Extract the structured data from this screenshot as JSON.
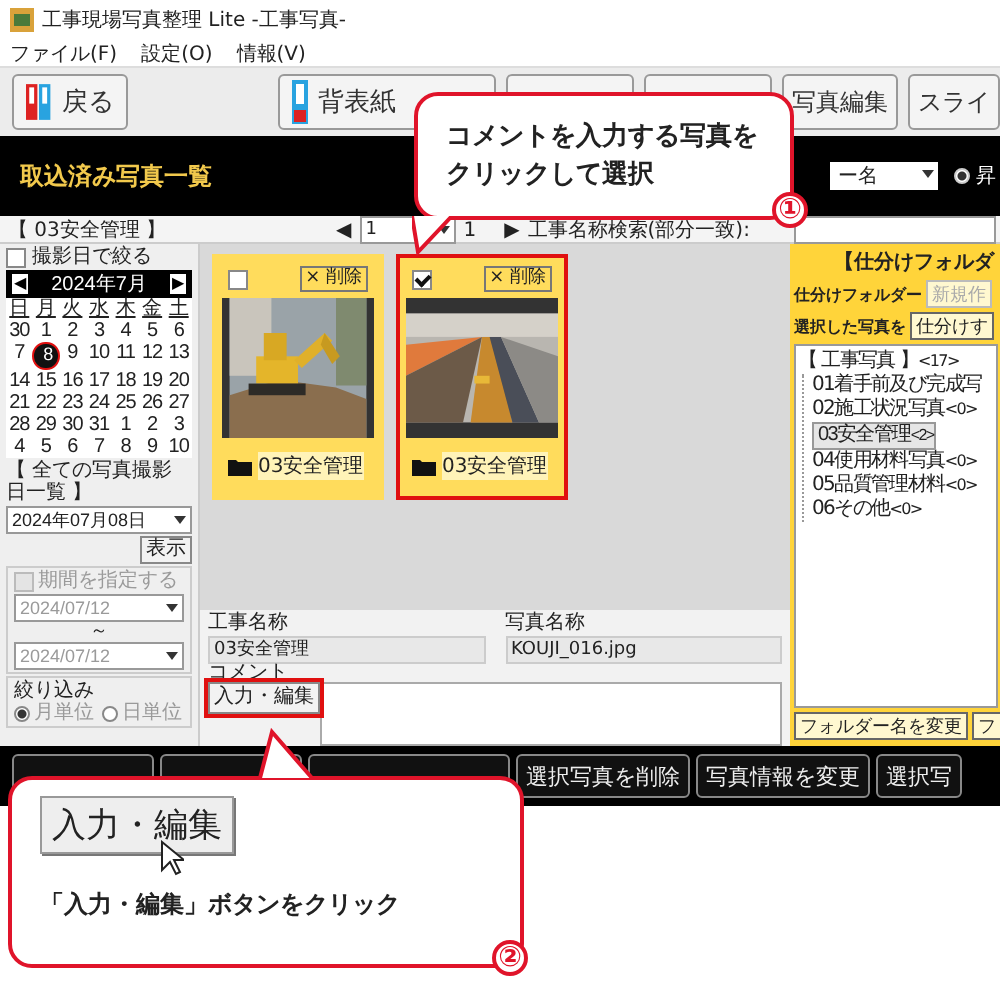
{
  "window": {
    "title": "工事現場写真整理 Lite -工事写真-"
  },
  "menu": [
    "ファイル(F)",
    "設定(O)",
    "情報(V)"
  ],
  "toolbar": [
    {
      "kind": "back",
      "label": "戻る"
    },
    {
      "kind": "spine",
      "label": "背表紙"
    },
    {
      "kind": "covered"
    },
    {
      "kind": "covered"
    },
    {
      "kind": "plain",
      "label": "写真編集"
    },
    {
      "kind": "plain",
      "label": "スライ"
    }
  ],
  "header": {
    "title": "取込済み写真一覧",
    "sort_select": "ー名",
    "sort_radio": {
      "label": "昇",
      "selected": true
    }
  },
  "folder_label": "【 03安全管理 】",
  "date_filter": {
    "label": "撮影日で絞る",
    "checked": false
  },
  "calendar": {
    "prev": "◀",
    "title": "2024年7月",
    "next": "▶",
    "weekdays": [
      "日",
      "月",
      "火",
      "水",
      "木",
      "金",
      "土"
    ],
    "weeks": [
      [
        {
          "d": "30",
          "selected": false
        },
        {
          "d": "1",
          "selected": false
        },
        {
          "d": "2",
          "selected": false
        },
        {
          "d": "3",
          "selected": false
        },
        {
          "d": "4",
          "selected": false
        },
        {
          "d": "5",
          "selected": false
        },
        {
          "d": "6",
          "selected": false
        }
      ],
      [
        {
          "d": "7",
          "selected": false
        },
        {
          "d": "8",
          "selected": true
        },
        {
          "d": "9",
          "selected": false
        },
        {
          "d": "10",
          "selected": false
        },
        {
          "d": "11",
          "selected": false
        },
        {
          "d": "12",
          "selected": false
        },
        {
          "d": "13",
          "selected": false
        }
      ],
      [
        {
          "d": "14",
          "selected": false
        },
        {
          "d": "15",
          "selected": false
        },
        {
          "d": "16",
          "selected": false
        },
        {
          "d": "17",
          "selected": false
        },
        {
          "d": "18",
          "selected": false
        },
        {
          "d": "19",
          "selected": false
        },
        {
          "d": "20",
          "selected": false
        }
      ],
      [
        {
          "d": "21",
          "selected": false
        },
        {
          "d": "22",
          "selected": false
        },
        {
          "d": "23",
          "selected": false
        },
        {
          "d": "24",
          "selected": false
        },
        {
          "d": "25",
          "selected": false
        },
        {
          "d": "26",
          "selected": false
        },
        {
          "d": "27",
          "selected": false
        }
      ],
      [
        {
          "d": "28",
          "selected": false
        },
        {
          "d": "29",
          "selected": false
        },
        {
          "d": "30",
          "selected": false
        },
        {
          "d": "31",
          "selected": false
        },
        {
          "d": "1",
          "selected": false
        },
        {
          "d": "2",
          "selected": false
        },
        {
          "d": "3",
          "selected": false
        }
      ],
      [
        {
          "d": "4",
          "selected": false
        },
        {
          "d": "5",
          "selected": false
        },
        {
          "d": "6",
          "selected": false
        },
        {
          "d": "7",
          "selected": false
        },
        {
          "d": "8",
          "selected": false
        },
        {
          "d": "9",
          "selected": false
        },
        {
          "d": "10",
          "selected": false
        }
      ]
    ]
  },
  "all_dates": {
    "label": "【 全ての写真撮影日一覧 】",
    "value": "2024年07月08日",
    "button": "表示"
  },
  "period": {
    "label": "期間を指定する",
    "checked": false,
    "disabled": true,
    "from": "2024/07/12",
    "sep": "～",
    "to": "2024/07/12"
  },
  "narrow": {
    "label": "絞り込み",
    "options": [
      {
        "label": "月単位",
        "selected": true
      },
      {
        "label": "日単位",
        "selected": false
      }
    ]
  },
  "pager": {
    "prev": "◀",
    "page": "1",
    "total": "1",
    "next": "▶",
    "search_label": "工事名称検索(部分一致):"
  },
  "photos": [
    {
      "checked": false,
      "selected": false,
      "delete": "× 削除",
      "folder": "03安全管理"
    },
    {
      "checked": true,
      "selected": true,
      "delete": "× 削除",
      "folder": "03安全管理"
    }
  ],
  "info": {
    "project_label": "工事名称",
    "project": "03安全管理",
    "photo_label": "写真名称",
    "photo": "KOUJI_016.jpg",
    "comment_label": "コメント",
    "edit_button": "入力・編集",
    "edit_highlighted": true
  },
  "sort_panel": {
    "title": "【仕分けフォルダ",
    "folder_label": "仕分けフォルダー",
    "new_button": "新規作",
    "selected_label": "選択した写真を",
    "sort_button": "仕分けす",
    "tree": [
      {
        "label": "【 工事写真 】",
        "count": "<17>",
        "selected": false,
        "children": [
          {
            "label": "01着手前及び完成写",
            "selected": false
          },
          {
            "label": "02施工状況写真",
            "count": "<0>",
            "selected": false
          },
          {
            "label": "03安全管理",
            "count": "<2>",
            "selected": true
          },
          {
            "label": "04使用材料写真",
            "count": "<0>",
            "selected": false
          },
          {
            "label": "05品質管理材料",
            "count": "<0>",
            "selected": false
          },
          {
            "label": "06その他",
            "count": "<0>",
            "selected": false
          }
        ]
      }
    ],
    "buttons": [
      "フォルダー名を変更",
      "フ"
    ]
  },
  "bottom_buttons": [
    {
      "kind": "covered"
    },
    {
      "kind": "covered"
    },
    {
      "kind": "covered"
    },
    {
      "kind": "plain",
      "label": "選択写真を削除"
    },
    {
      "kind": "plain",
      "label": "写真情報を変更"
    },
    {
      "kind": "plain",
      "label": "選択写"
    }
  ],
  "callouts": [
    {
      "kind": "text",
      "lines": [
        "コメントを入力する写真を",
        "クリックして選択"
      ],
      "number": "①"
    },
    {
      "kind": "button",
      "button": "入力・編集",
      "lines": [
        "「入力・編集」ボタンをクリック"
      ],
      "number": "②"
    }
  ]
}
